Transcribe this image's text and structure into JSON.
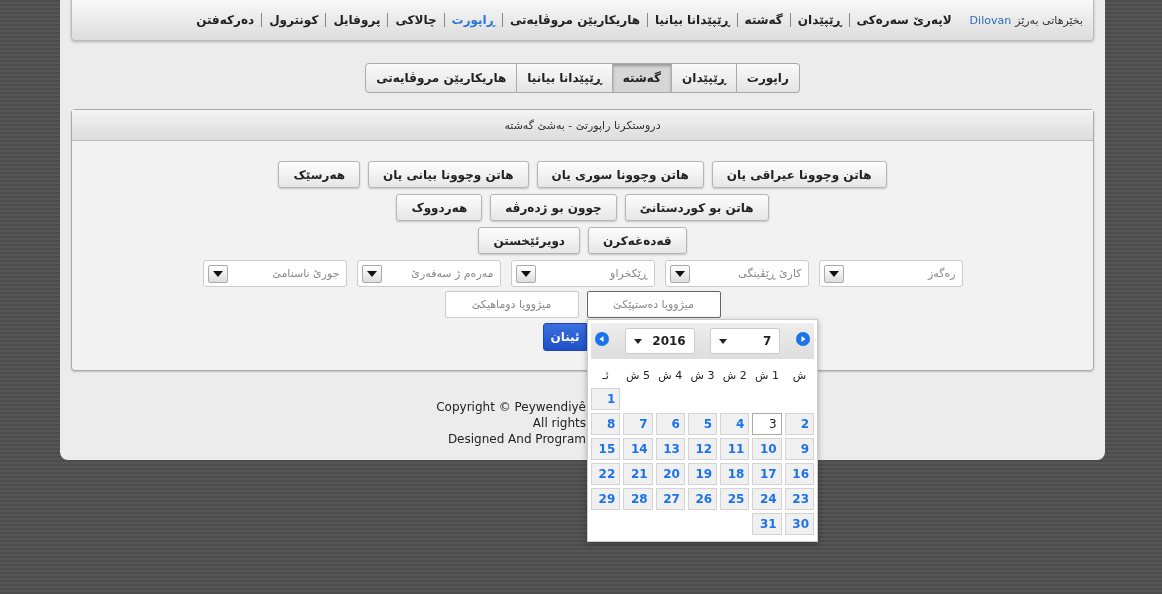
{
  "nav": {
    "welcome": "بخێرهاتی بەرێز",
    "user": "Dilovan",
    "items": [
      {
        "label": "لاپەرێ سەرەکی",
        "selected": false
      },
      {
        "label": "ڕێپێدان",
        "selected": false
      },
      {
        "label": "گەشتە",
        "selected": false
      },
      {
        "label": "ڕێپێدانا بیانیا",
        "selected": false
      },
      {
        "label": "هاریکاریێن مروڤایەتی",
        "selected": false
      },
      {
        "label": "ڕاپورت",
        "selected": true
      },
      {
        "label": "چالاکی",
        "selected": false
      },
      {
        "label": "پروفایل",
        "selected": false
      },
      {
        "label": "کونترول",
        "selected": false
      },
      {
        "label": "دەرکەفتن",
        "selected": false
      }
    ]
  },
  "tabs": [
    {
      "label": "راپورت",
      "selected": false
    },
    {
      "label": "ڕێپێدان",
      "selected": false
    },
    {
      "label": "گەشتە",
      "selected": true
    },
    {
      "label": "ڕێپێدانا بیانیا",
      "selected": false
    },
    {
      "label": "هاریکاریێن مروڤایەتی",
      "selected": false
    }
  ],
  "section": {
    "title": "دروستکرنا راپورتێ - بەشێ گەشتە",
    "button_rows": [
      [
        "هاتن وچوونا عیراقی یان",
        "هاتن وچوونا سوری یان",
        "هاتن وچوونا بیانی یان",
        "هەرسێک"
      ],
      [
        "هاتن بو کوردستانێ",
        "چوون بو ژدەرڤە",
        "هەردووک"
      ],
      [
        "قەدەغەکرن",
        "دویرئێخستن"
      ]
    ],
    "dropdowns": [
      {
        "placeholder": "رەگەز"
      },
      {
        "placeholder": "کارێ ڕێڤینگی"
      },
      {
        "placeholder": "ڕێکخراو"
      },
      {
        "placeholder": "مەرەم ژ سەفەرێ"
      },
      {
        "placeholder": "جورێ ناسنامێ"
      }
    ],
    "date_fields": [
      {
        "placeholder": "میژوویا دەستپێکێ",
        "focused": true
      },
      {
        "placeholder": "میژوویا دوماهیکێ",
        "focused": false
      }
    ],
    "submit": "ئینان"
  },
  "footer": [
    "Copyright © Peywendiyê",
    "All rights",
    "Designed And Program"
  ],
  "calendar": {
    "month": "7",
    "year": "2016",
    "weekdays": [
      "ش",
      "1 ش",
      "2 ش",
      "3 ش",
      "4 ش",
      "5 ش",
      "ئـ"
    ],
    "weeks": [
      [
        {
          "day": "1",
          "selected": false
        }
      ],
      [
        {
          "day": "2",
          "selected": false
        },
        {
          "day": "3",
          "selected": true
        },
        {
          "day": "4",
          "selected": false
        },
        {
          "day": "5",
          "selected": false
        },
        {
          "day": "6",
          "selected": false
        },
        {
          "day": "7",
          "selected": false
        },
        {
          "day": "8",
          "selected": false
        }
      ],
      [
        {
          "day": "9",
          "selected": false
        },
        {
          "day": "10",
          "selected": false
        },
        {
          "day": "11",
          "selected": false
        },
        {
          "day": "12",
          "selected": false
        },
        {
          "day": "13",
          "selected": false
        },
        {
          "day": "14",
          "selected": false
        },
        {
          "day": "15",
          "selected": false
        }
      ],
      [
        {
          "day": "16",
          "selected": false
        },
        {
          "day": "17",
          "selected": false
        },
        {
          "day": "18",
          "selected": false
        },
        {
          "day": "19",
          "selected": false
        },
        {
          "day": "20",
          "selected": false
        },
        {
          "day": "21",
          "selected": false
        },
        {
          "day": "22",
          "selected": false
        }
      ],
      [
        {
          "day": "23",
          "selected": false
        },
        {
          "day": "24",
          "selected": false
        },
        {
          "day": "25",
          "selected": false
        },
        {
          "day": "26",
          "selected": false
        },
        {
          "day": "27",
          "selected": false
        },
        {
          "day": "28",
          "selected": false
        },
        {
          "day": "29",
          "selected": false
        }
      ],
      [
        {
          "day": "30",
          "selected": false
        },
        {
          "day": "31",
          "selected": false
        }
      ]
    ]
  }
}
